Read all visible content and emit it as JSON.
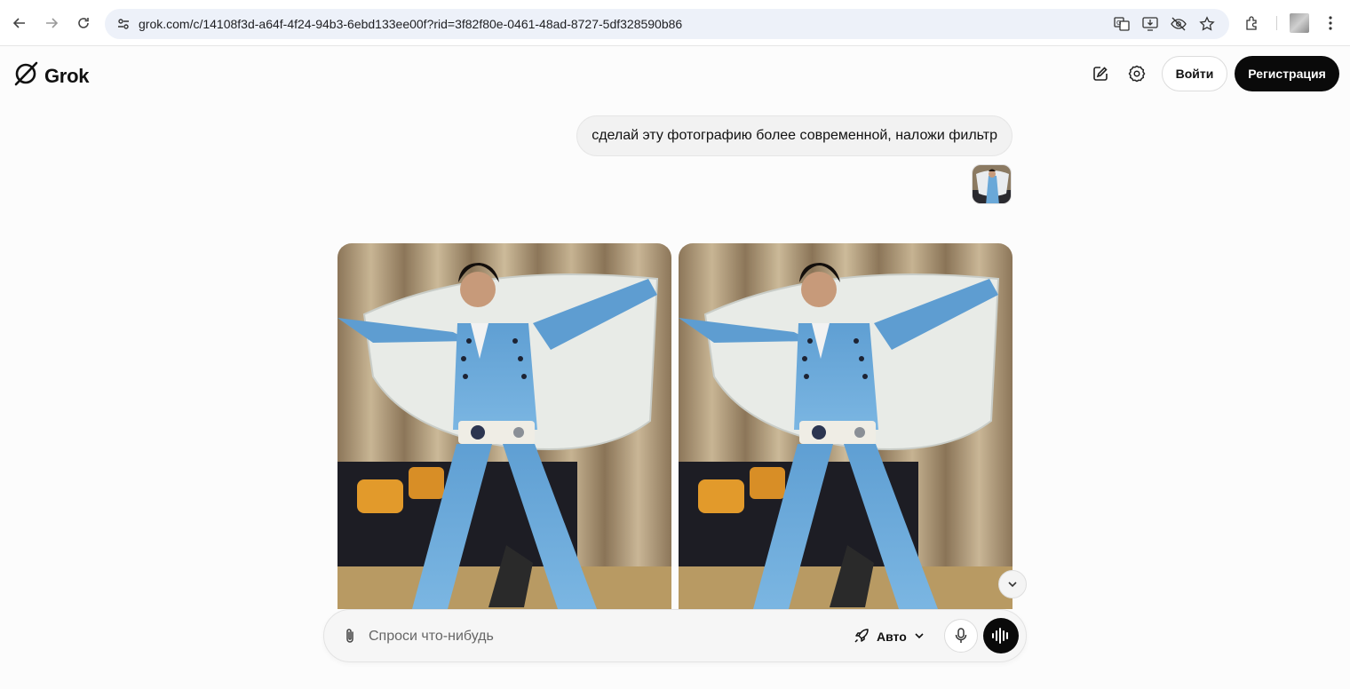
{
  "browser": {
    "url": "grok.com/c/14108f3d-a64f-4f24-94b3-6ebd133ee00f?rid=3f82f80e-0461-48ad-8727-5df328590b86",
    "icons": [
      "back-icon",
      "forward-icon",
      "reload-icon",
      "site-settings-icon",
      "translate-icon",
      "install-app-icon",
      "eye-off-icon",
      "star-icon",
      "extensions-icon",
      "profile-avatar",
      "more-vert-icon"
    ]
  },
  "app": {
    "logo": "Grok",
    "header": {
      "login_label": "Войти",
      "signup_label": "Регистрация"
    }
  },
  "chat": {
    "user_message": "сделай эту фотографию более современной, наложи фильтр"
  },
  "composer": {
    "placeholder": "Спроси что-нибудь",
    "mode": "Авто"
  },
  "colors": {
    "accent_dark": "#0a0a0a",
    "bubble_bg": "#f2f2f2",
    "page_bg": "#fcfcfc"
  }
}
